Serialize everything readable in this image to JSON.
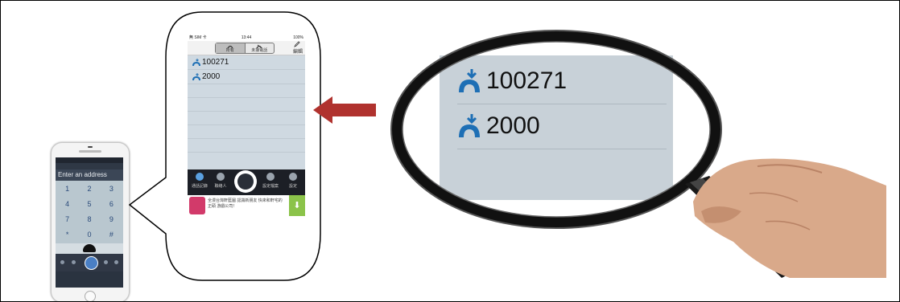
{
  "small_phone": {
    "address_placeholder": "Enter an address",
    "keypad": [
      {
        "digit": "1",
        "sub": ""
      },
      {
        "digit": "2",
        "sub": ""
      },
      {
        "digit": "3",
        "sub": ""
      },
      {
        "digit": "4",
        "sub": ""
      },
      {
        "digit": "5",
        "sub": ""
      },
      {
        "digit": "6",
        "sub": ""
      },
      {
        "digit": "7",
        "sub": ""
      },
      {
        "digit": "8",
        "sub": ""
      },
      {
        "digit": "9",
        "sub": ""
      },
      {
        "digit": "*",
        "sub": ""
      },
      {
        "digit": "0",
        "sub": ""
      },
      {
        "digit": "#",
        "sub": ""
      }
    ]
  },
  "screenshot": {
    "status": {
      "carrier": "無 SIM 卡",
      "time": "13:44",
      "battery": "100%"
    },
    "tabs": [
      {
        "label": "所有"
      },
      {
        "label": "未接電話"
      }
    ],
    "edit_label": "編輯",
    "calls": [
      {
        "number": "100271"
      },
      {
        "number": "2000"
      }
    ],
    "nav": [
      {
        "label": "通話記錄"
      },
      {
        "label": "聯絡人"
      },
      {
        "label": ""
      },
      {
        "label": "設定檔案"
      },
      {
        "label": "設定"
      }
    ],
    "ad_text": "全漫台灣軒藍圖 認識新朋友 快來和軒宅的正碩 游戲公司！",
    "download_icon": "download-arrow-icon"
  },
  "magnified": {
    "calls": [
      {
        "number": "100271"
      },
      {
        "number": "2000"
      }
    ]
  },
  "colors": {
    "arrow": "#b0322e",
    "call_icon": "#1e6fb5",
    "screen_bg": "#cfd9e1"
  }
}
